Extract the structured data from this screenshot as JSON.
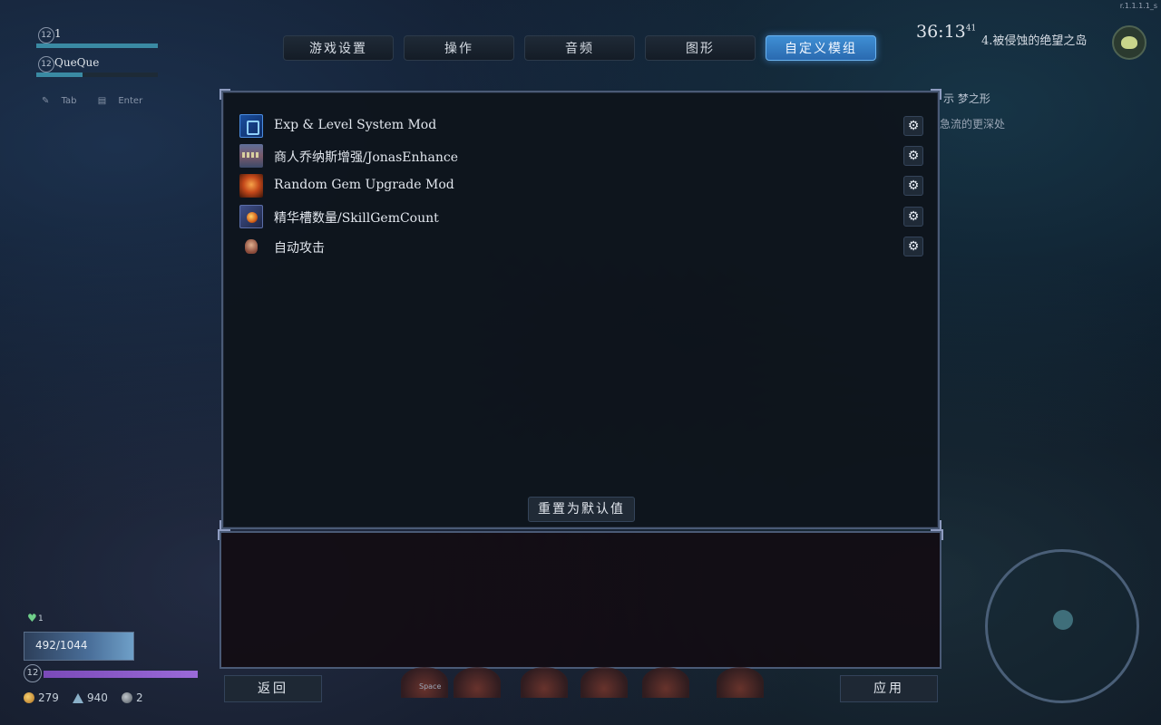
{
  "version": "r.1.1.1.1_s",
  "party": [
    {
      "level": "12",
      "name": "1",
      "hp_fraction": 1.0
    },
    {
      "level": "12",
      "name": "QueQue",
      "hp_fraction": 0.38
    }
  ],
  "hints": {
    "tab": "Tab",
    "enter": "Enter"
  },
  "tabs": [
    {
      "label": "游戏设置",
      "active": false
    },
    {
      "label": "操作",
      "active": false
    },
    {
      "label": "音频",
      "active": false
    },
    {
      "label": "图形",
      "active": false
    },
    {
      "label": "自定义模组",
      "active": true
    }
  ],
  "quest": {
    "timer": "36:13",
    "timer_small": "41",
    "title": "4.被侵蚀的绝望之岛",
    "objective": "示 梦之形",
    "objective_sub": "急流的更深处"
  },
  "mods": [
    {
      "name": "Exp & Level System Mod",
      "icon": "exp-level-icon"
    },
    {
      "name": "商人乔纳斯增强/JonasEnhance",
      "icon": "merchant-icon"
    },
    {
      "name": "Random Gem Upgrade Mod",
      "icon": "gem-icon"
    },
    {
      "name": "精华槽数量/SkillGemCount",
      "icon": "skill-gem-icon"
    },
    {
      "name": "自动攻击",
      "icon": "auto-attack-icon"
    }
  ],
  "buttons": {
    "reset": "重置为默认值",
    "back": "返回",
    "apply": "应用"
  },
  "player": {
    "hp": "492/1044",
    "hp_fraction": 0.47,
    "level": "12",
    "hearts": "1",
    "xp_fraction": 1.0,
    "gold": "279",
    "shards": "940",
    "orbs": "2"
  },
  "skillbar": {
    "space_label": "Space"
  },
  "colors": {
    "accent": "#3f8fd4",
    "panel_border": "#4a5a76"
  }
}
